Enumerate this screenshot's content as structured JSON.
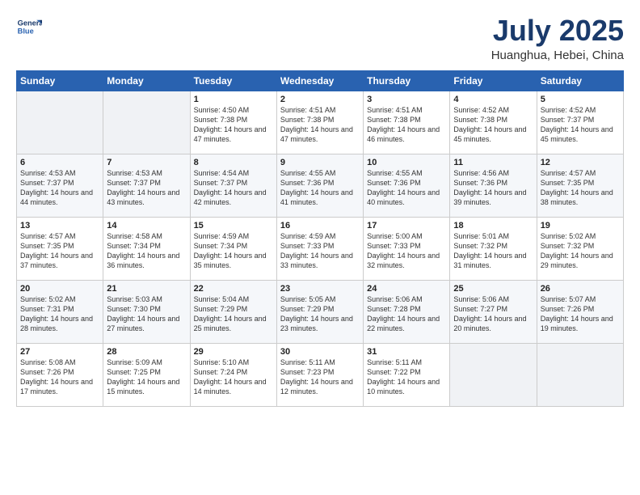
{
  "header": {
    "logo_line1": "General",
    "logo_line2": "Blue",
    "month": "July 2025",
    "location": "Huanghua, Hebei, China"
  },
  "days_of_week": [
    "Sunday",
    "Monday",
    "Tuesday",
    "Wednesday",
    "Thursday",
    "Friday",
    "Saturday"
  ],
  "weeks": [
    [
      {
        "day": "",
        "info": ""
      },
      {
        "day": "",
        "info": ""
      },
      {
        "day": "1",
        "info": "Sunrise: 4:50 AM\nSunset: 7:38 PM\nDaylight: 14 hours and 47 minutes."
      },
      {
        "day": "2",
        "info": "Sunrise: 4:51 AM\nSunset: 7:38 PM\nDaylight: 14 hours and 47 minutes."
      },
      {
        "day": "3",
        "info": "Sunrise: 4:51 AM\nSunset: 7:38 PM\nDaylight: 14 hours and 46 minutes."
      },
      {
        "day": "4",
        "info": "Sunrise: 4:52 AM\nSunset: 7:38 PM\nDaylight: 14 hours and 45 minutes."
      },
      {
        "day": "5",
        "info": "Sunrise: 4:52 AM\nSunset: 7:37 PM\nDaylight: 14 hours and 45 minutes."
      }
    ],
    [
      {
        "day": "6",
        "info": "Sunrise: 4:53 AM\nSunset: 7:37 PM\nDaylight: 14 hours and 44 minutes."
      },
      {
        "day": "7",
        "info": "Sunrise: 4:53 AM\nSunset: 7:37 PM\nDaylight: 14 hours and 43 minutes."
      },
      {
        "day": "8",
        "info": "Sunrise: 4:54 AM\nSunset: 7:37 PM\nDaylight: 14 hours and 42 minutes."
      },
      {
        "day": "9",
        "info": "Sunrise: 4:55 AM\nSunset: 7:36 PM\nDaylight: 14 hours and 41 minutes."
      },
      {
        "day": "10",
        "info": "Sunrise: 4:55 AM\nSunset: 7:36 PM\nDaylight: 14 hours and 40 minutes."
      },
      {
        "day": "11",
        "info": "Sunrise: 4:56 AM\nSunset: 7:36 PM\nDaylight: 14 hours and 39 minutes."
      },
      {
        "day": "12",
        "info": "Sunrise: 4:57 AM\nSunset: 7:35 PM\nDaylight: 14 hours and 38 minutes."
      }
    ],
    [
      {
        "day": "13",
        "info": "Sunrise: 4:57 AM\nSunset: 7:35 PM\nDaylight: 14 hours and 37 minutes."
      },
      {
        "day": "14",
        "info": "Sunrise: 4:58 AM\nSunset: 7:34 PM\nDaylight: 14 hours and 36 minutes."
      },
      {
        "day": "15",
        "info": "Sunrise: 4:59 AM\nSunset: 7:34 PM\nDaylight: 14 hours and 35 minutes."
      },
      {
        "day": "16",
        "info": "Sunrise: 4:59 AM\nSunset: 7:33 PM\nDaylight: 14 hours and 33 minutes."
      },
      {
        "day": "17",
        "info": "Sunrise: 5:00 AM\nSunset: 7:33 PM\nDaylight: 14 hours and 32 minutes."
      },
      {
        "day": "18",
        "info": "Sunrise: 5:01 AM\nSunset: 7:32 PM\nDaylight: 14 hours and 31 minutes."
      },
      {
        "day": "19",
        "info": "Sunrise: 5:02 AM\nSunset: 7:32 PM\nDaylight: 14 hours and 29 minutes."
      }
    ],
    [
      {
        "day": "20",
        "info": "Sunrise: 5:02 AM\nSunset: 7:31 PM\nDaylight: 14 hours and 28 minutes."
      },
      {
        "day": "21",
        "info": "Sunrise: 5:03 AM\nSunset: 7:30 PM\nDaylight: 14 hours and 27 minutes."
      },
      {
        "day": "22",
        "info": "Sunrise: 5:04 AM\nSunset: 7:29 PM\nDaylight: 14 hours and 25 minutes."
      },
      {
        "day": "23",
        "info": "Sunrise: 5:05 AM\nSunset: 7:29 PM\nDaylight: 14 hours and 23 minutes."
      },
      {
        "day": "24",
        "info": "Sunrise: 5:06 AM\nSunset: 7:28 PM\nDaylight: 14 hours and 22 minutes."
      },
      {
        "day": "25",
        "info": "Sunrise: 5:06 AM\nSunset: 7:27 PM\nDaylight: 14 hours and 20 minutes."
      },
      {
        "day": "26",
        "info": "Sunrise: 5:07 AM\nSunset: 7:26 PM\nDaylight: 14 hours and 19 minutes."
      }
    ],
    [
      {
        "day": "27",
        "info": "Sunrise: 5:08 AM\nSunset: 7:26 PM\nDaylight: 14 hours and 17 minutes."
      },
      {
        "day": "28",
        "info": "Sunrise: 5:09 AM\nSunset: 7:25 PM\nDaylight: 14 hours and 15 minutes."
      },
      {
        "day": "29",
        "info": "Sunrise: 5:10 AM\nSunset: 7:24 PM\nDaylight: 14 hours and 14 minutes."
      },
      {
        "day": "30",
        "info": "Sunrise: 5:11 AM\nSunset: 7:23 PM\nDaylight: 14 hours and 12 minutes."
      },
      {
        "day": "31",
        "info": "Sunrise: 5:11 AM\nSunset: 7:22 PM\nDaylight: 14 hours and 10 minutes."
      },
      {
        "day": "",
        "info": ""
      },
      {
        "day": "",
        "info": ""
      }
    ]
  ]
}
